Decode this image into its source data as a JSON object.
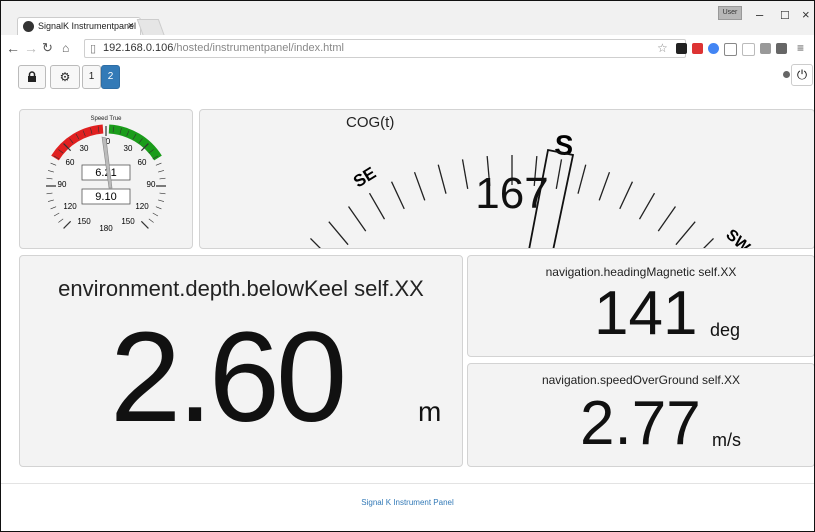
{
  "browser": {
    "tab_title": "SignalK Instrumentpanel",
    "tab_close": "×",
    "user_badge": "User",
    "window_controls": {
      "minimize": "–",
      "maximize": "☐",
      "close": "×"
    },
    "url_host": "192.168.0.106",
    "url_path": "/hosted/instrumentpanel/index.html"
  },
  "toolbar": {
    "page_buttons": [
      "1",
      "2"
    ],
    "active_page": "2"
  },
  "speed_gauge": {
    "title": "Speed True",
    "ticks": [
      "0",
      "30",
      "30",
      "60",
      "60",
      "90",
      "90",
      "120",
      "120",
      "150",
      "150",
      "180"
    ],
    "value_top": "6.21",
    "value_bottom": "9.10",
    "needle_value": 6.21,
    "red_zone": [
      0,
      70
    ],
    "green_zone": [
      0,
      70
    ]
  },
  "cog": {
    "label": "COG(t)",
    "value": "167",
    "marks": {
      "se": "SE",
      "s": "S",
      "sw": "SW"
    }
  },
  "depth": {
    "label": "environment.depth.belowKeel self.XX",
    "value": "2.60",
    "unit": "m"
  },
  "heading": {
    "label": "navigation.headingMagnetic self.XX",
    "value": "141",
    "unit": "deg"
  },
  "sog": {
    "label": "navigation.speedOverGround self.XX",
    "value": "2.77",
    "unit": "m/s"
  },
  "footer": {
    "text": "Signal K Instrument Panel"
  },
  "colors": {
    "accent": "#337ab7",
    "red_zone": "#e02020",
    "green_zone": "#1a9c1a"
  }
}
